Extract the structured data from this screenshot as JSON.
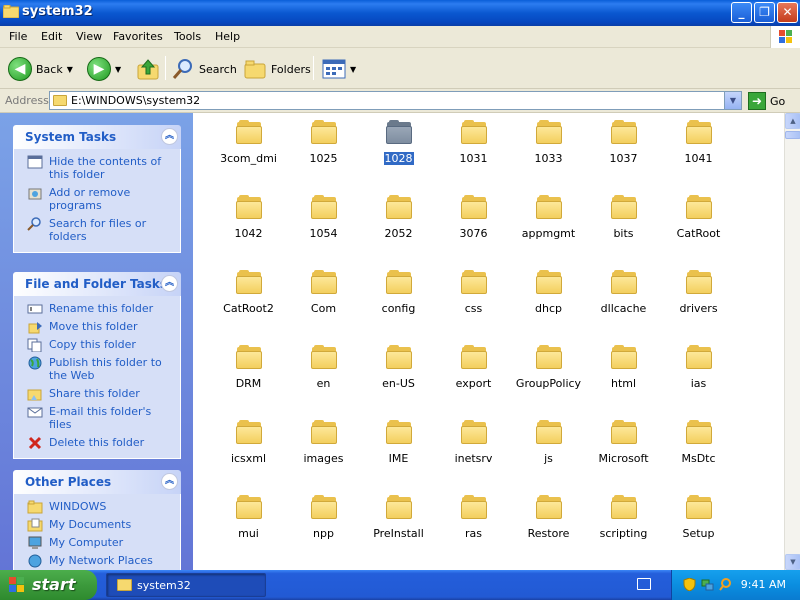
{
  "window": {
    "title": "system32"
  },
  "menubar": {
    "items": [
      "File",
      "Edit",
      "View",
      "Favorites",
      "Tools",
      "Help"
    ]
  },
  "toolbar": {
    "back_label": "Back",
    "search_label": "Search",
    "folders_label": "Folders"
  },
  "address": {
    "label": "Address",
    "value": "E:\\WINDOWS\\system32",
    "go_label": "Go"
  },
  "system_tasks": {
    "title": "System Tasks",
    "items": [
      {
        "label": "Hide the contents of this folder",
        "icon": "hide-contents-icon"
      },
      {
        "label": "Add or remove programs",
        "icon": "add-remove-programs-icon"
      },
      {
        "label": "Search for files or folders",
        "icon": "search-files-icon"
      }
    ]
  },
  "file_folder_tasks": {
    "title": "File and Folder Tasks",
    "items": [
      {
        "label": "Rename this folder",
        "icon": "rename-icon"
      },
      {
        "label": "Move this folder",
        "icon": "move-icon"
      },
      {
        "label": "Copy this folder",
        "icon": "copy-icon"
      },
      {
        "label": "Publish this folder to the Web",
        "icon": "globe-icon"
      },
      {
        "label": "Share this folder",
        "icon": "share-icon"
      },
      {
        "label": "E-mail this folder's files",
        "icon": "email-icon"
      },
      {
        "label": "Delete this folder",
        "icon": "delete-icon"
      }
    ]
  },
  "other_places": {
    "title": "Other Places",
    "items": [
      {
        "label": "WINDOWS",
        "icon": "folder-icon"
      },
      {
        "label": "My Documents",
        "icon": "my-documents-icon"
      },
      {
        "label": "My Computer",
        "icon": "my-computer-icon"
      },
      {
        "label": "My Network Places",
        "icon": "network-places-icon"
      }
    ]
  },
  "folders": [
    "3com_dmi",
    "1025",
    "1028",
    "1031",
    "1033",
    "1037",
    "1041",
    "1042",
    "1054",
    "2052",
    "3076",
    "appmgmt",
    "bits",
    "CatRoot",
    "CatRoot2",
    "Com",
    "config",
    "css",
    "dhcp",
    "dllcache",
    "drivers",
    "DRM",
    "en",
    "en-US",
    "export",
    "GroupPolicy",
    "html",
    "ias",
    "icsxml",
    "images",
    "IME",
    "inetsrv",
    "js",
    "Microsoft",
    "MsDtc",
    "mui",
    "npp",
    "PreInstall",
    "ras",
    "Restore",
    "scripting",
    "Setup"
  ],
  "selected_folder": "1028",
  "taskbar": {
    "start_label": "start",
    "window_label": "system32",
    "clock": "9:41 AM"
  },
  "colors": {
    "titlebar_blue": "#0a58d0",
    "task_link": "#215dc6",
    "selection": "#316ac5",
    "start_green": "#3c9a3c",
    "folder_yellow": "#f3cf5e"
  }
}
